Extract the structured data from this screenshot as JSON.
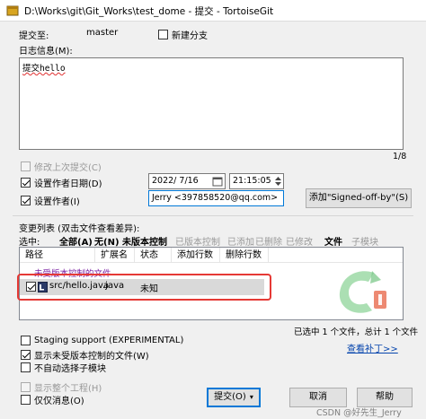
{
  "window": {
    "title": "D:\\Works\\git\\Git_Works\\test_dome - 提交 - TortoiseGit"
  },
  "branch": {
    "label": "提交至:",
    "value": "master",
    "new_branch_label": "新建分支"
  },
  "message": {
    "label": "日志信息(M):",
    "text": "提交hello",
    "counter": "1/8"
  },
  "options": {
    "amend_label": "修改上次提交(C)",
    "set_date_label": "设置作者日期(D)",
    "date_value": "2022/ 7/16",
    "time_value": "21:15:05",
    "set_author_label": "设置作者(I)",
    "author_value": "Jerry <397858520@qq.com>",
    "signed_off_button": "添加\"Signed-off-by\"(S)"
  },
  "changes": {
    "label": "变更列表 (双击文件查看差异):",
    "select_label": "选中:",
    "filters": [
      {
        "label": "全部(A)",
        "state": "on"
      },
      {
        "label": "无(N)",
        "state": "on"
      },
      {
        "label": "未版本控制",
        "state": "on"
      },
      {
        "label": "已版本控制",
        "state": "off"
      },
      {
        "label": "已添加",
        "state": "off"
      },
      {
        "label": "已删除",
        "state": "off"
      },
      {
        "label": "已修改",
        "state": "off"
      },
      {
        "label": "文件",
        "state": "on"
      },
      {
        "label": "子模块",
        "state": "off"
      }
    ],
    "columns": [
      "路径",
      "扩展名",
      "状态",
      "添加行数",
      "删除行数"
    ],
    "group_header": "未受版本控制的文件",
    "rows": [
      {
        "path": "src/hello.java",
        "ext": ".java",
        "status": "未知",
        "checked": true
      }
    ],
    "selection_status": "已选中 1 个文件，总计 1 个文件",
    "view_patch_link": "查看补丁>>"
  },
  "bottom": {
    "staging_label": "Staging support (EXPERIMENTAL)",
    "show_unversioned_label": "显示未受版本控制的文件(W)",
    "no_auto_select_submodules_label": "不自动选择子模块",
    "show_whole_project_label": "显示整个工程(H)",
    "message_only_label": "仅仅消息(O)",
    "commit_button": "提交(O)",
    "cancel_button": "取消",
    "help_button": "帮助"
  },
  "watermark": "CSDN @好先生_Jerry",
  "colors": {
    "accent": "#0078d7",
    "highlight_box": "#e53935",
    "unversioned_group": "#7a1fa2",
    "link": "#0645ad"
  }
}
